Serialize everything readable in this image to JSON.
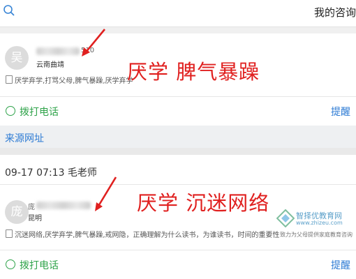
{
  "header": {
    "title": "我的咨询",
    "search_icon": "search-icon"
  },
  "cards": [
    {
      "avatar_char": "吴",
      "name_suffix": "510",
      "city": "云南曲靖",
      "tags": "厌学弃学,打骂父母,脾气暴躁,厌学弃学",
      "annotation": "厌学 脾气暴躁",
      "call_label": "拨打电话",
      "remind_label": "提醒"
    },
    {
      "time": "09-17 07:13 毛老师",
      "avatar_char": "庞",
      "name_prefix": "庞",
      "city": "昆明",
      "tags": "沉迷网络,厌学弃学,脾气暴躁,戒网隐，正确理解为什么读书，为谁读书，时间的重要性",
      "annotation": "厌学 沉迷网络",
      "call_label": "拨打电话",
      "remind_label": "提醒"
    }
  ],
  "source_link": "来源网址",
  "watermark": {
    "name": "智择优教育网",
    "url": "www.zhizeu.com",
    "slogan": "致力为父母提供家庭教育咨询"
  },
  "colors": {
    "annotation_red": "#e0201f",
    "call_green": "#2fa34a",
    "link_blue": "#2d7bd4"
  }
}
